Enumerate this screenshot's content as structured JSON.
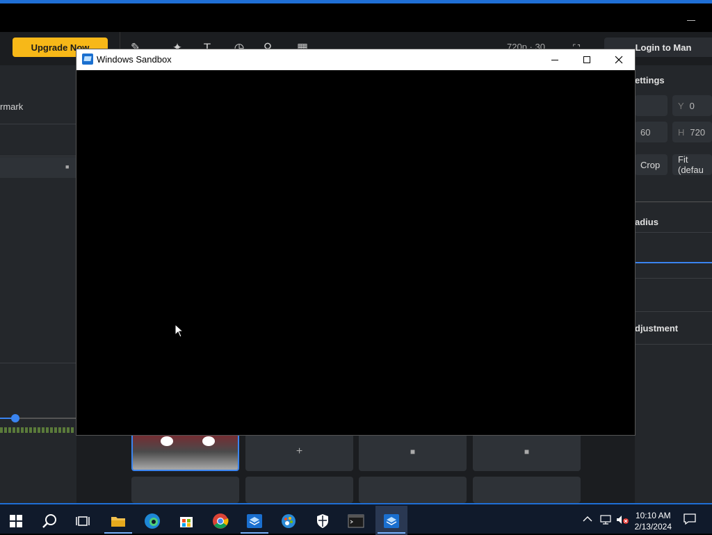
{
  "app": {
    "upgrade_label": "Upgrade Now",
    "quality_label": "720p · 30",
    "login_label": "Login to Man",
    "left_panel": {
      "watermark_label": "rmark"
    },
    "right_panel": {
      "settings_label": "ettings",
      "y_key": "Y",
      "y_value": "0",
      "w_partial": "60",
      "h_key": "H",
      "h_value": "720",
      "crop_label": "Crop",
      "fit_label": "Fit (defau",
      "radius_label": "adius",
      "adjustment_label": "djustment"
    },
    "grid": {
      "add_symbol": "+",
      "lock_symbol": "🔒"
    }
  },
  "sandbox": {
    "title": "Windows Sandbox"
  },
  "taskbar": {
    "time": "10:10 AM",
    "date": "2/13/2024",
    "pinned": [
      "start-icon",
      "search-icon",
      "task-view-icon",
      "file-explorer-icon",
      "edge-icon",
      "store-icon",
      "chrome-icon",
      "sandbox-icon",
      "paint-icon",
      "security-icon",
      "terminal-icon",
      "sandbox-icon"
    ]
  },
  "colors": {
    "accent": "#1f6fd6",
    "upgrade_button": "#f7b818",
    "app_bg": "#1b1d20",
    "panel_bg": "#24272b",
    "taskbar_bg": "#101a2b"
  }
}
